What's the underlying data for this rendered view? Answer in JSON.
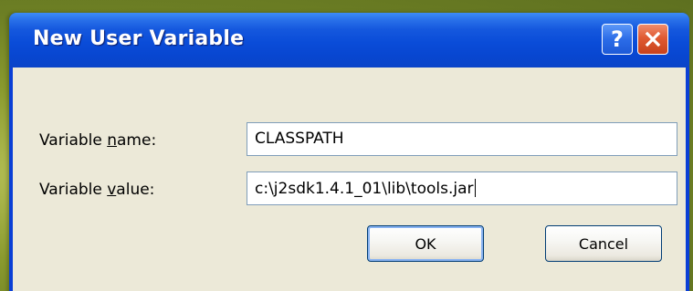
{
  "window": {
    "title": "New User Variable",
    "help_glyph": "?",
    "close_icon": "close-x-icon"
  },
  "form": {
    "name_label_pre": "Variable ",
    "name_label_accel": "n",
    "name_label_post": "ame:",
    "name_value": "CLASSPATH",
    "value_label_pre": "Variable ",
    "value_label_accel": "v",
    "value_label_post": "alue:",
    "value_value": "c:\\j2sdk1.4.1_01\\lib\\tools.jar"
  },
  "buttons": {
    "ok_label": "OK",
    "cancel_label": "Cancel"
  },
  "colors": {
    "titlebar": "#0a4cd8",
    "client": "#ece9d8",
    "close_button": "#e05a32",
    "desktop": "#8a9a2e"
  }
}
